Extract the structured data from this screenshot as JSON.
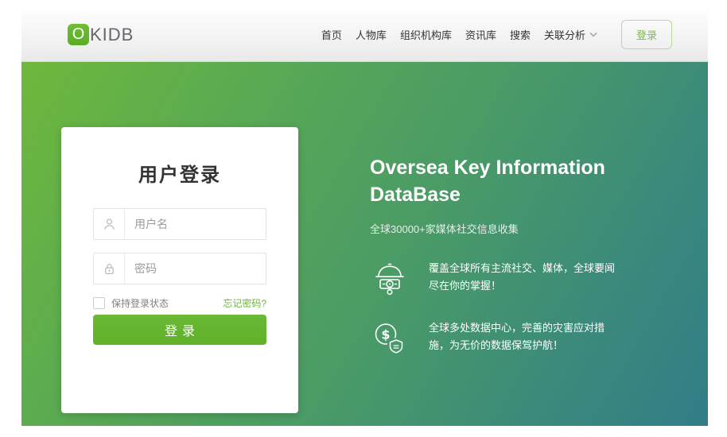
{
  "header": {
    "logo_o": "O",
    "logo_text": "KIDB",
    "nav": [
      {
        "label": "首页"
      },
      {
        "label": "人物库"
      },
      {
        "label": "组织机构库"
      },
      {
        "label": "资讯库"
      },
      {
        "label": "搜索"
      },
      {
        "label": "关联分析"
      }
    ],
    "login_button": "登录"
  },
  "login_card": {
    "title": "用户登录",
    "username_placeholder": "用户名",
    "password_placeholder": "密码",
    "remember_label": "保持登录状态",
    "forgot_link": "忘记密码?",
    "submit_label": "登录"
  },
  "hero": {
    "title": "Oversea Key Information DataBase",
    "subtitle": "全球30000+家媒体社交信息收集",
    "features": [
      {
        "icon": "coverage-dome-icon",
        "text": "覆盖全球所有主流社交、媒体，全球要闻尽在你的掌握！"
      },
      {
        "icon": "dollar-shield-icon",
        "text": "全球多处数据中心，完善的灾害应对措施，为无价的数据保驾护航！"
      }
    ]
  },
  "colors": {
    "accent_green": "#65b42f",
    "gradient_start": "#6eb83c",
    "gradient_end": "#327d88",
    "link_green": "#6cb43f",
    "logo_gray": "#63676b"
  }
}
